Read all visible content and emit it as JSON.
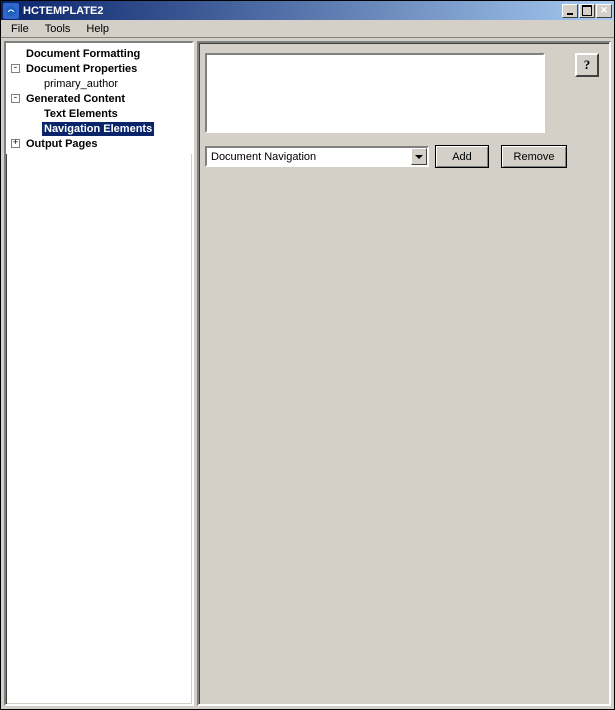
{
  "window": {
    "title": "HCTEMPLATE2"
  },
  "menu": {
    "file": "File",
    "tools": "Tools",
    "help": "Help"
  },
  "tree": {
    "doc_formatting": "Document Formatting",
    "doc_properties": "Document Properties",
    "primary_author": "primary_author",
    "generated_content": "Generated Content",
    "text_elements": "Text Elements",
    "navigation_elements": "Navigation Elements",
    "output_pages": "Output Pages"
  },
  "panel": {
    "help": "?",
    "dropdown_value": "Document Navigation",
    "add": "Add",
    "remove": "Remove"
  }
}
